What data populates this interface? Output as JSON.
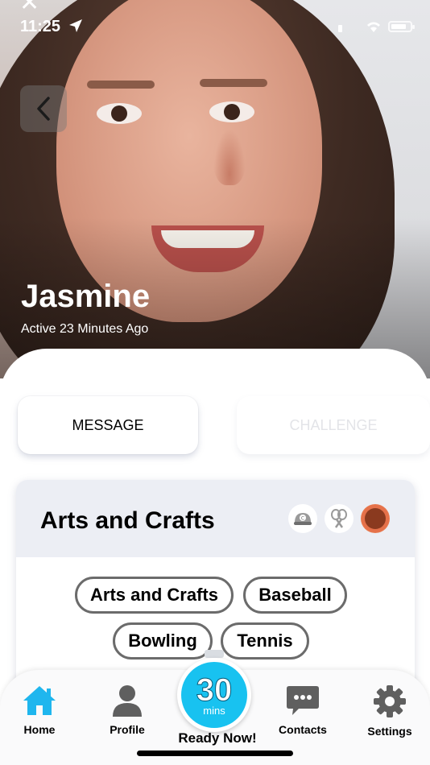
{
  "status_bar": {
    "time": "11:25"
  },
  "profile": {
    "name": "Jasmine",
    "activity": "Active 23 Minutes Ago"
  },
  "actions": {
    "message_label": "MESSAGE",
    "challenge_label": "CHALLENGE"
  },
  "card": {
    "title": "Arts and Crafts",
    "sport_icons": [
      "cap-icon",
      "tennis-rackets-icon",
      "basketball-icon"
    ],
    "chips": [
      "Arts and Crafts",
      "Baseball",
      "Bowling",
      "Tennis"
    ]
  },
  "tabbar": {
    "home_label": "Home",
    "profile_label": "Profile",
    "timer_value": "30",
    "timer_unit": "mins",
    "ready_label": "Ready Now!",
    "contacts_label": "Contacts",
    "settings_label": "Settings"
  },
  "colors": {
    "accent": "#18c2f0",
    "active_tab": "#1fb6ee",
    "inactive_tab": "#5f5f5f",
    "chip_border": "#6b6b6b"
  }
}
